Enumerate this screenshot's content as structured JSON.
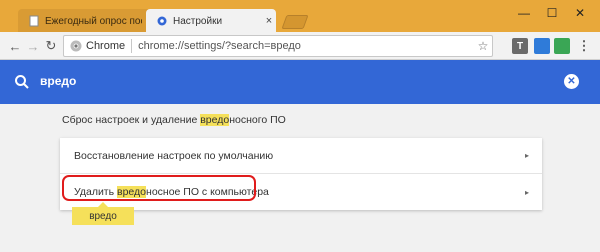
{
  "tabs": [
    {
      "title": "Ежегодный опрос посе",
      "close": "×"
    },
    {
      "title": "Настройки",
      "close": "×"
    }
  ],
  "window_controls": {
    "minimize": "—",
    "maximize": "☐",
    "close": "✕"
  },
  "toolbar": {
    "back": "←",
    "forward": "→",
    "reload": "↻",
    "site_label": "Chrome",
    "url": "chrome://settings/?search=вредо",
    "star": "☆",
    "extensions": [
      "T",
      "",
      "",
      ""
    ]
  },
  "search": {
    "query": "вредо",
    "clear": "✕"
  },
  "section": {
    "title_before": "Сброс настроек и удаление ",
    "title_highlight": "вредо",
    "title_after": "носного ПО"
  },
  "rows": [
    {
      "label": "Восстановление настроек по умолчанию",
      "chevron": "▸"
    },
    {
      "label_before": "Удалить ",
      "label_highlight": "вредо",
      "label_after": "носное ПО с компьютера",
      "chevron": "▸"
    }
  ],
  "tooltip": {
    "text": "вредо"
  },
  "colors": {
    "accent": "#3367d6",
    "highlight": "#f5e05a",
    "annotation": "#e01c1c",
    "frame": "#e8a83a"
  }
}
